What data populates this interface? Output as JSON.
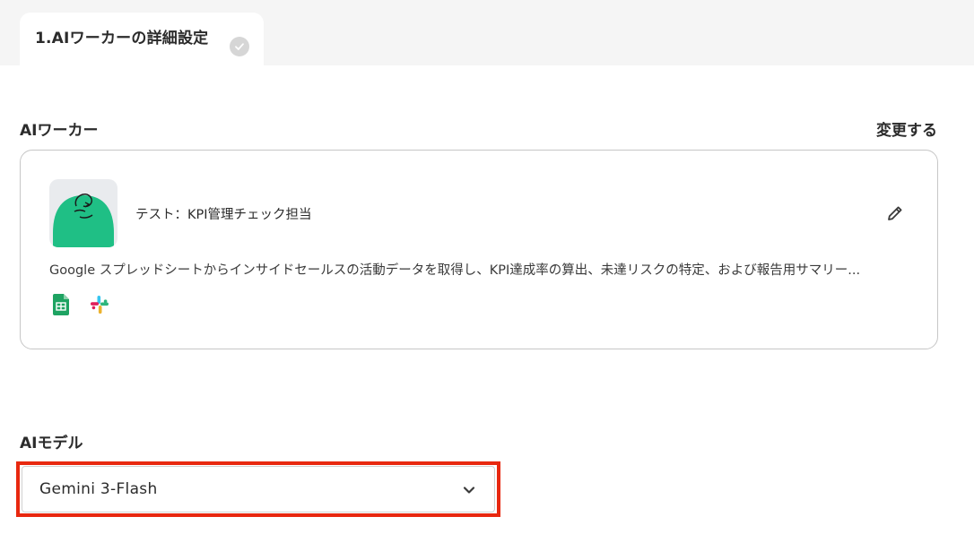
{
  "step_tab": {
    "label": "1.AIワーカーの詳細設定",
    "status_icon": "check-icon"
  },
  "ai_worker_section": {
    "label": "AIワーカー",
    "change_link": "変更する",
    "worker": {
      "name": "テスト：KPI管理チェック担当",
      "description": "Google スプレッドシートからインサイドセールスの活動データを取得し、KPI達成率の算出、未達リスクの特定、および報告用サマリー...",
      "avatar_color": "#1fbf85",
      "apps": [
        "google-sheets-icon",
        "slack-icon"
      ]
    }
  },
  "ai_model_section": {
    "label": "AIモデル",
    "selected_model": "Gemini 3-Flash",
    "highlight_color": "#e8280f"
  }
}
